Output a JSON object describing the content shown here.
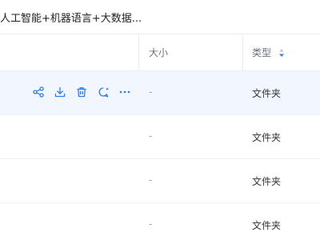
{
  "breadcrumb": {
    "path": "人工智能+机器语言+大数据..."
  },
  "table": {
    "columns": {
      "size": "大小",
      "type": "类型"
    },
    "rows": [
      {
        "size": "-",
        "type": "文件夹"
      },
      {
        "size": "-",
        "type": "文件夹"
      },
      {
        "size": "-",
        "type": "文件夹"
      },
      {
        "size": "-",
        "type": "文件夹"
      }
    ],
    "row_actions": [
      "share-icon",
      "download-icon",
      "delete-icon",
      "ai-chat-icon",
      "more-icon"
    ]
  },
  "colors": {
    "accent": "#2a7cf6",
    "hover_row": "#f2f7ff"
  }
}
